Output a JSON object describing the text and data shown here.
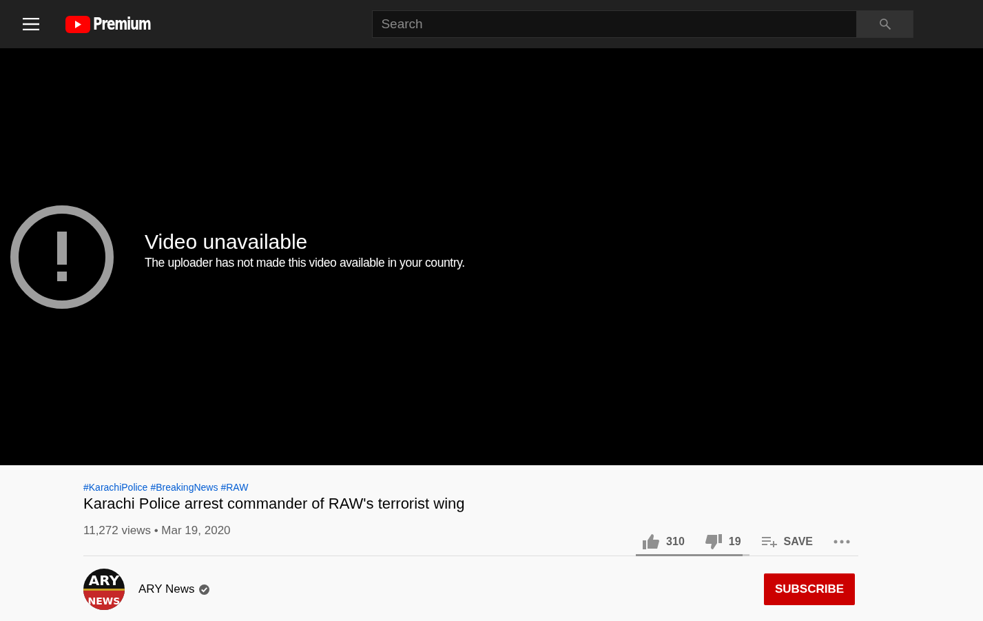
{
  "header": {
    "logo_text": "Premium",
    "search": {
      "placeholder": "Search"
    }
  },
  "player": {
    "error_title": "Video unavailable",
    "error_message": "The uploader has not made this video available in your country."
  },
  "video": {
    "hashtags": [
      "#KarachiPolice",
      "#BreakingNews",
      "#RAW"
    ],
    "title": "Karachi Police arrest commander of RAW's terrorist wing",
    "views": "11,272 views",
    "separator": "•",
    "date": "Mar 19, 2020",
    "likes": "310",
    "dislikes": "19",
    "save": "SAVE",
    "sentiment": {
      "level": 0.94
    }
  },
  "channel": {
    "logo_top": "ARY",
    "logo_bottom": "NEWS",
    "name": "ARY News",
    "verified": true,
    "subscribe": "SUBSCRIBE"
  }
}
